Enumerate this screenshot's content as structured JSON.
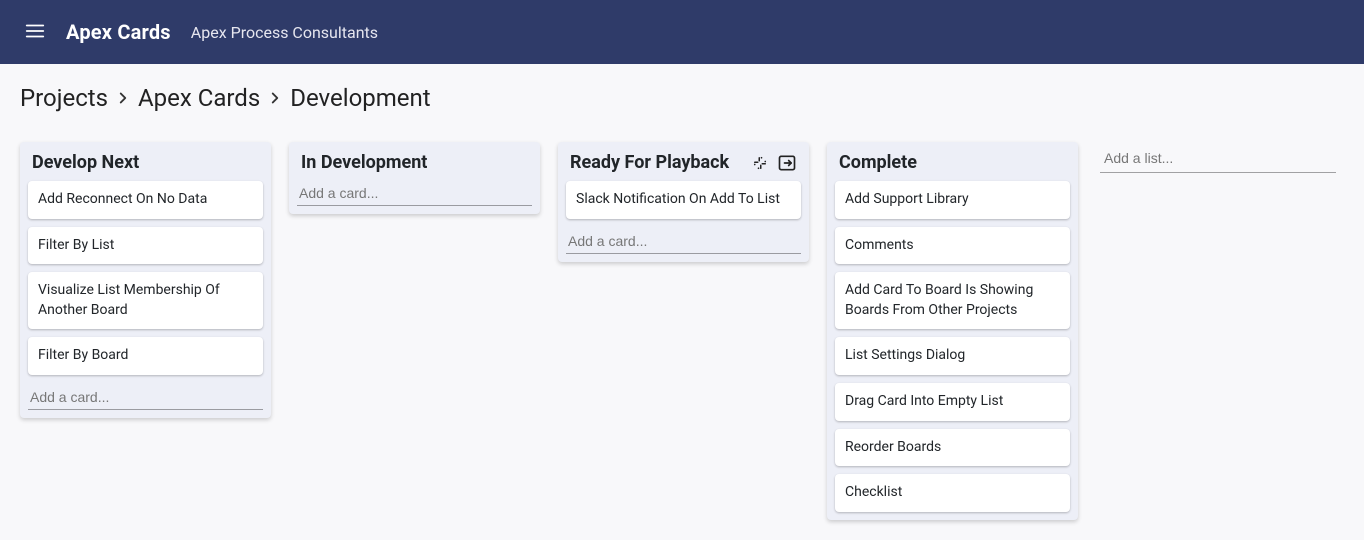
{
  "header": {
    "app_title": "Apex Cards",
    "org_name": "Apex Process Consultants"
  },
  "breadcrumbs": [
    {
      "label": "Projects"
    },
    {
      "label": "Apex Cards"
    },
    {
      "label": "Development"
    }
  ],
  "placeholders": {
    "add_card": "Add a card...",
    "add_list": "Add a list..."
  },
  "lists": [
    {
      "title": "Develop Next",
      "icons": [],
      "cards": [
        "Add Reconnect On No Data",
        "Filter By List",
        "Visualize List Membership Of Another Board",
        "Filter By Board"
      ]
    },
    {
      "title": "In Development",
      "icons": [],
      "cards": []
    },
    {
      "title": "Ready For Playback",
      "icons": [
        "slack-icon",
        "move-out-icon"
      ],
      "cards": [
        "Slack Notification On Add To List"
      ]
    },
    {
      "title": "Complete",
      "icons": [],
      "cards": [
        "Add Support Library",
        "Comments",
        "Add Card To Board Is Showing Boards From Other Projects",
        "List Settings Dialog",
        "Drag Card Into Empty List",
        "Reorder Boards",
        "Checklist"
      ]
    }
  ]
}
